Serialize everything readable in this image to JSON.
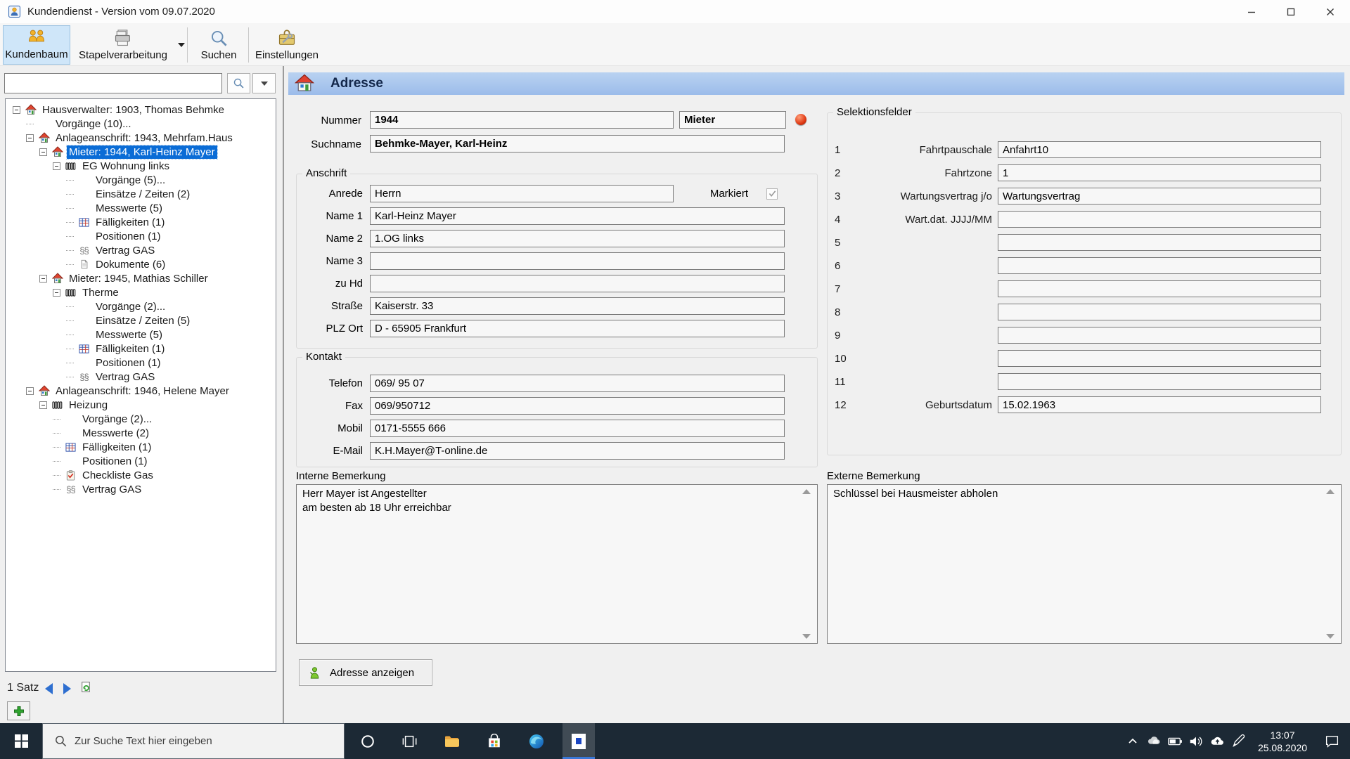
{
  "window": {
    "title": "Kundendienst - Version vom 09.07.2020",
    "controls": [
      "minimize",
      "maximize",
      "close"
    ]
  },
  "toolbar": {
    "buttons": [
      {
        "id": "kundenbaum",
        "label": "Kundenbaum",
        "icon": "customers-people-icon",
        "active": true
      },
      {
        "id": "stapelverarbeitung",
        "label": "Stapelverarbeitung",
        "icon": "batch-printer-icon",
        "has_dropdown": true
      },
      {
        "id": "suchen",
        "label": "Suchen",
        "icon": "search-icon",
        "active": false
      },
      {
        "id": "einstellungen",
        "label": "Einstellungen",
        "icon": "settings-toolbox-icon",
        "active": false
      }
    ]
  },
  "sidebar": {
    "search_value": "",
    "tree": [
      {
        "level": 0,
        "expander": true,
        "icon": "house",
        "label": "Hausverwalter: 1903, Thomas Behmke"
      },
      {
        "level": 1,
        "expander": false,
        "icon": null,
        "label": "Vorgänge (10)..."
      },
      {
        "level": 1,
        "expander": true,
        "icon": "house",
        "label": "Anlageanschrift: 1943, Mehrfam.Haus"
      },
      {
        "level": 2,
        "expander": true,
        "icon": "house",
        "label": "Mieter: 1944, Karl-Heinz Mayer",
        "selected": true
      },
      {
        "level": 3,
        "expander": true,
        "icon": "radiator",
        "label": "EG Wohnung links"
      },
      {
        "level": 4,
        "expander": false,
        "icon": null,
        "label": "Vorgänge (5)..."
      },
      {
        "level": 4,
        "expander": false,
        "icon": null,
        "label": "Einsätze / Zeiten (2)"
      },
      {
        "level": 4,
        "expander": false,
        "icon": null,
        "label": "Messwerte (5)"
      },
      {
        "level": 4,
        "expander": false,
        "icon": "table",
        "label": "Fälligkeiten (1)"
      },
      {
        "level": 4,
        "expander": false,
        "icon": null,
        "label": "Positionen (1)"
      },
      {
        "level": 4,
        "expander": false,
        "icon": "paragraph",
        "label": "Vertrag GAS"
      },
      {
        "level": 4,
        "expander": false,
        "icon": "document",
        "label": "Dokumente (6)"
      },
      {
        "level": 2,
        "expander": true,
        "icon": "house",
        "label": "Mieter: 1945, Mathias Schiller"
      },
      {
        "level": 3,
        "expander": true,
        "icon": "radiator",
        "label": "Therme"
      },
      {
        "level": 4,
        "expander": false,
        "icon": null,
        "label": "Vorgänge (2)..."
      },
      {
        "level": 4,
        "expander": false,
        "icon": null,
        "label": "Einsätze / Zeiten (5)"
      },
      {
        "level": 4,
        "expander": false,
        "icon": null,
        "label": "Messwerte (5)"
      },
      {
        "level": 4,
        "expander": false,
        "icon": "table",
        "label": "Fälligkeiten (1)"
      },
      {
        "level": 4,
        "expander": false,
        "icon": null,
        "label": "Positionen (1)"
      },
      {
        "level": 4,
        "expander": false,
        "icon": "paragraph",
        "label": "Vertrag GAS"
      },
      {
        "level": 1,
        "expander": true,
        "icon": "house",
        "label": "Anlageanschrift: 1946, Helene Mayer"
      },
      {
        "level": 2,
        "expander": true,
        "icon": "radiator",
        "label": "Heizung"
      },
      {
        "level": 3,
        "expander": false,
        "icon": null,
        "label": "Vorgänge (2)..."
      },
      {
        "level": 3,
        "expander": false,
        "icon": null,
        "label": "Messwerte (2)"
      },
      {
        "level": 3,
        "expander": false,
        "icon": "table",
        "label": "Fälligkeiten (1)"
      },
      {
        "level": 3,
        "expander": false,
        "icon": null,
        "label": "Positionen (1)"
      },
      {
        "level": 3,
        "expander": false,
        "icon": "checklist",
        "label": "Checkliste Gas"
      },
      {
        "level": 3,
        "expander": false,
        "icon": "paragraph",
        "label": "Vertrag GAS"
      }
    ],
    "status": {
      "record_count": "1 Satz"
    }
  },
  "main": {
    "header": {
      "title": "Adresse",
      "icon": "address-house-icon"
    },
    "record": {
      "nummer_label": "Nummer",
      "nummer": "1944",
      "typ": "Mieter",
      "suchname_label": "Suchname",
      "suchname": "Behmke-Mayer, Karl-Heinz"
    },
    "anschrift": {
      "title": "Anschrift",
      "anrede": {
        "label": "Anrede",
        "value": "Herrn"
      },
      "markiert": {
        "label": "Markiert",
        "checked": true
      },
      "name1": {
        "label": "Name 1",
        "value": "Karl-Heinz Mayer"
      },
      "name2": {
        "label": "Name 2",
        "value": "1.OG links"
      },
      "name3": {
        "label": "Name 3",
        "value": ""
      },
      "zu_hd": {
        "label": "zu Hd",
        "value": ""
      },
      "strasse": {
        "label": "Straße",
        "value": "Kaiserstr. 33"
      },
      "plz_ort": {
        "label": "PLZ Ort",
        "value": "D - 65905 Frankfurt"
      }
    },
    "kontakt": {
      "title": "Kontakt",
      "telefon": {
        "label": "Telefon",
        "value": "069/ 95 07"
      },
      "fax": {
        "label": "Fax",
        "value": "069/950712"
      },
      "mobil": {
        "label": "Mobil",
        "value": "0171-5555 666"
      },
      "email": {
        "label": "E-Mail",
        "value": "K.H.Mayer@T-online.de"
      }
    },
    "selektionsfelder": {
      "title": "Selektionsfelder",
      "rows": [
        {
          "num": "1",
          "label": "Fahrtpauschale",
          "value": "Anfahrt10"
        },
        {
          "num": "2",
          "label": "Fahrtzone",
          "value": "1"
        },
        {
          "num": "3",
          "label": "Wartungsvertrag j/o",
          "value": "Wartungsvertrag"
        },
        {
          "num": "4",
          "label": "Wart.dat. JJJJ/MM",
          "value": ""
        },
        {
          "num": "5",
          "label": "",
          "value": ""
        },
        {
          "num": "6",
          "label": "",
          "value": ""
        },
        {
          "num": "7",
          "label": "",
          "value": ""
        },
        {
          "num": "8",
          "label": "",
          "value": ""
        },
        {
          "num": "9",
          "label": "",
          "value": ""
        },
        {
          "num": "10",
          "label": "",
          "value": ""
        },
        {
          "num": "11",
          "label": "",
          "value": ""
        },
        {
          "num": "12",
          "label": "Geburtsdatum",
          "value": "15.02.1963"
        }
      ]
    },
    "interne_bemerkung": {
      "title": "Interne Bemerkung",
      "text": "Herr Mayer ist Angestellter\nam besten ab 18 Uhr erreichbar"
    },
    "externe_bemerkung": {
      "title": "Externe Bemerkung",
      "text": "Schlüssel bei Hausmeister abholen"
    },
    "actions": {
      "adresse_anzeigen": "Adresse anzeigen"
    }
  },
  "taskbar": {
    "search_placeholder": "Zur Suche Text hier eingeben",
    "pinned_icons": [
      "start",
      "cortana",
      "task-view",
      "file-explorer",
      "store",
      "edge",
      "kundendienst-app-active"
    ],
    "tray_icons": [
      "chevron-up",
      "onedrive",
      "battery",
      "volume",
      "cloud-upload",
      "pen"
    ],
    "clock": {
      "time": "13:07",
      "date": "25.08.2020"
    },
    "notification_icon": "action-center"
  }
}
